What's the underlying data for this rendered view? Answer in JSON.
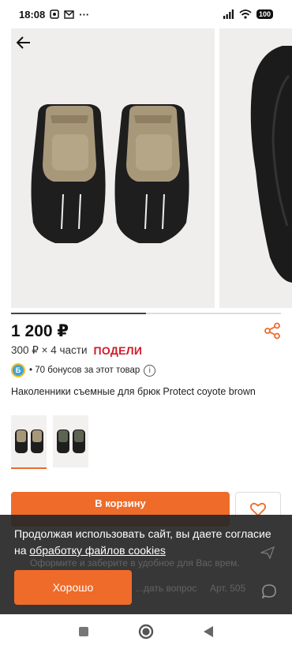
{
  "status_bar": {
    "time": "18:08",
    "battery": "100",
    "extra": "···"
  },
  "product": {
    "price": "1 200 ₽",
    "installment_text": "300 ₽ × 4 части",
    "installment_brand": "ПОДЕЛИ",
    "bonus_text": "• 70 бонусов за этот товар",
    "title": "Наколенники съемные для брюк Protect coyote brown"
  },
  "gallery": {
    "progress": 0.5
  },
  "cart": {
    "label": "В корзину"
  },
  "behind_text": {
    "line1": "Оформите и заберите в удобное для Вас врем.",
    "ask": "...дать вопрос",
    "article": "Арт. 505"
  },
  "cookie": {
    "text_before_link": "Продолжая использовать сайт, вы даете согласие на ",
    "link": "обработку файлов cookies",
    "ok_label": "Хорошо"
  },
  "colors": {
    "accent": "#ef6b2a",
    "podeli": "#d11a2a",
    "overlay": "#282828"
  }
}
